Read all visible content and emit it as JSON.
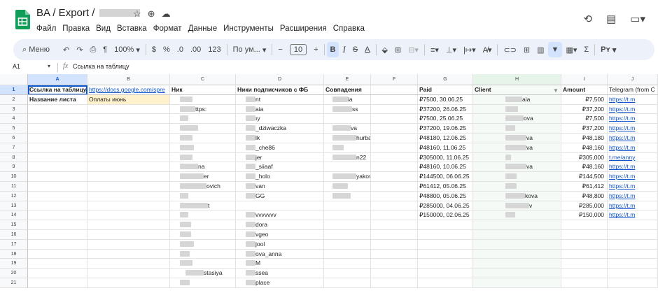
{
  "header": {
    "title_prefix": "BA / Export /",
    "icons": [
      "star-icon",
      "move-to-folder-icon",
      "cloud-saved-icon"
    ],
    "menu": [
      "Файл",
      "Правка",
      "Вид",
      "Вставка",
      "Формат",
      "Данные",
      "Инструменты",
      "Расширения",
      "Справка"
    ],
    "right_icons": [
      "history-icon",
      "comments-icon",
      "meet-icon"
    ]
  },
  "toolbar": {
    "search_label": "Меню",
    "zoom": "100%",
    "currency": "$",
    "percent": "%",
    "decimal_decrease": ".0",
    "decimal_increase": ".00",
    "number_format": "123",
    "font": "По ум...",
    "font_size": "10",
    "bold": "B",
    "italic": "I",
    "strike": "S",
    "text_color": "A",
    "sigma": "Σ",
    "input_tools": "Рʏ"
  },
  "formula_bar": {
    "cell_ref": "A1",
    "fx": "fx",
    "content": "Ссылка на таблицу"
  },
  "columns": [
    "A",
    "B",
    "C",
    "D",
    "E",
    "F",
    "G",
    "H",
    "I",
    "J"
  ],
  "rows": [
    "1",
    "2",
    "3",
    "4",
    "5",
    "6",
    "7",
    "8",
    "9",
    "10",
    "11",
    "12",
    "13",
    "14",
    "15",
    "16",
    "17",
    "18",
    "19",
    "20",
    "21"
  ],
  "sheet": {
    "A1": "Ссылка на таблицу",
    "B1": "https://docs.google.com/spre",
    "A2": "Название листа",
    "B2": "Оплаты июнь",
    "C1": "Ник",
    "D1": "Ники подписчиков с ФБ",
    "E1": "Совпадения",
    "G1": "Paid",
    "H1": "Client",
    "I1": "Amount",
    "J1": "Telegram (from C",
    "C_visible": [
      "",
      "ttps:",
      "",
      "",
      "",
      "",
      "",
      "na",
      "er",
      "ovich",
      "",
      "t",
      "",
      "",
      "",
      "",
      "",
      "",
      "stasiya",
      ""
    ],
    "D_visible": [
      "nt",
      "aia",
      "ıy",
      "_dziwaczka",
      "lk",
      "_che86",
      "jer",
      "_siiaaf",
      "_holo",
      "van",
      "GG",
      "",
      "vvvvvvv",
      "dora",
      "vgeo",
      "jool",
      "ova_anna",
      "M",
      "ssea",
      "place"
    ],
    "E_visible": [
      "ia",
      "ss",
      "",
      "va",
      "hurbanova",
      "",
      "n22",
      "",
      "yakova",
      "",
      "",
      "",
      "",
      "",
      "",
      "",
      "",
      "",
      "",
      ""
    ],
    "paid": [
      "₽7500, 30.06.25",
      "₽37200, 26.06.25",
      "₽7500, 25.06.25",
      "₽37200, 19.06.25",
      "₽48180, 12.06.25",
      "₽48160, 11.06.25",
      "₽305000, 11.06.25",
      "₽48160, 10.06.25",
      "₽144500, 06.06.25",
      "₽61412, 05.06.25",
      "₽48800, 05.06.25",
      "₽285000, 04.06.25",
      "₽150000, 02.06.25"
    ],
    "client_visible": [
      "aia",
      "",
      "ova",
      "",
      "va",
      "va",
      "",
      "va",
      "",
      "",
      "kova",
      "v",
      ""
    ],
    "amount": [
      "₽7,500",
      "₽37,200",
      "₽7,500",
      "₽37,200",
      "₽48,180",
      "₽48,160",
      "₽305,000",
      "₽48,160",
      "₽144,500",
      "₽61,412",
      "₽48,800",
      "₽285,000",
      "₽150,000"
    ],
    "telegram": [
      "https://t.m",
      "https://t.m",
      "https://t.m",
      "https://t.m",
      "https://t.m",
      "https://t.m",
      "t.me/anny",
      "https://t.m",
      "https://t.m",
      "https://t.m",
      "https://t.m",
      "https://t.m",
      "https://t.m"
    ]
  },
  "colors": {
    "toolbar_bg": "#edf2fa",
    "selection": "#0b57d0",
    "link": "#1155cc",
    "yellow_cell": "#fff2cc",
    "sheets_green": "#0f9d58"
  }
}
